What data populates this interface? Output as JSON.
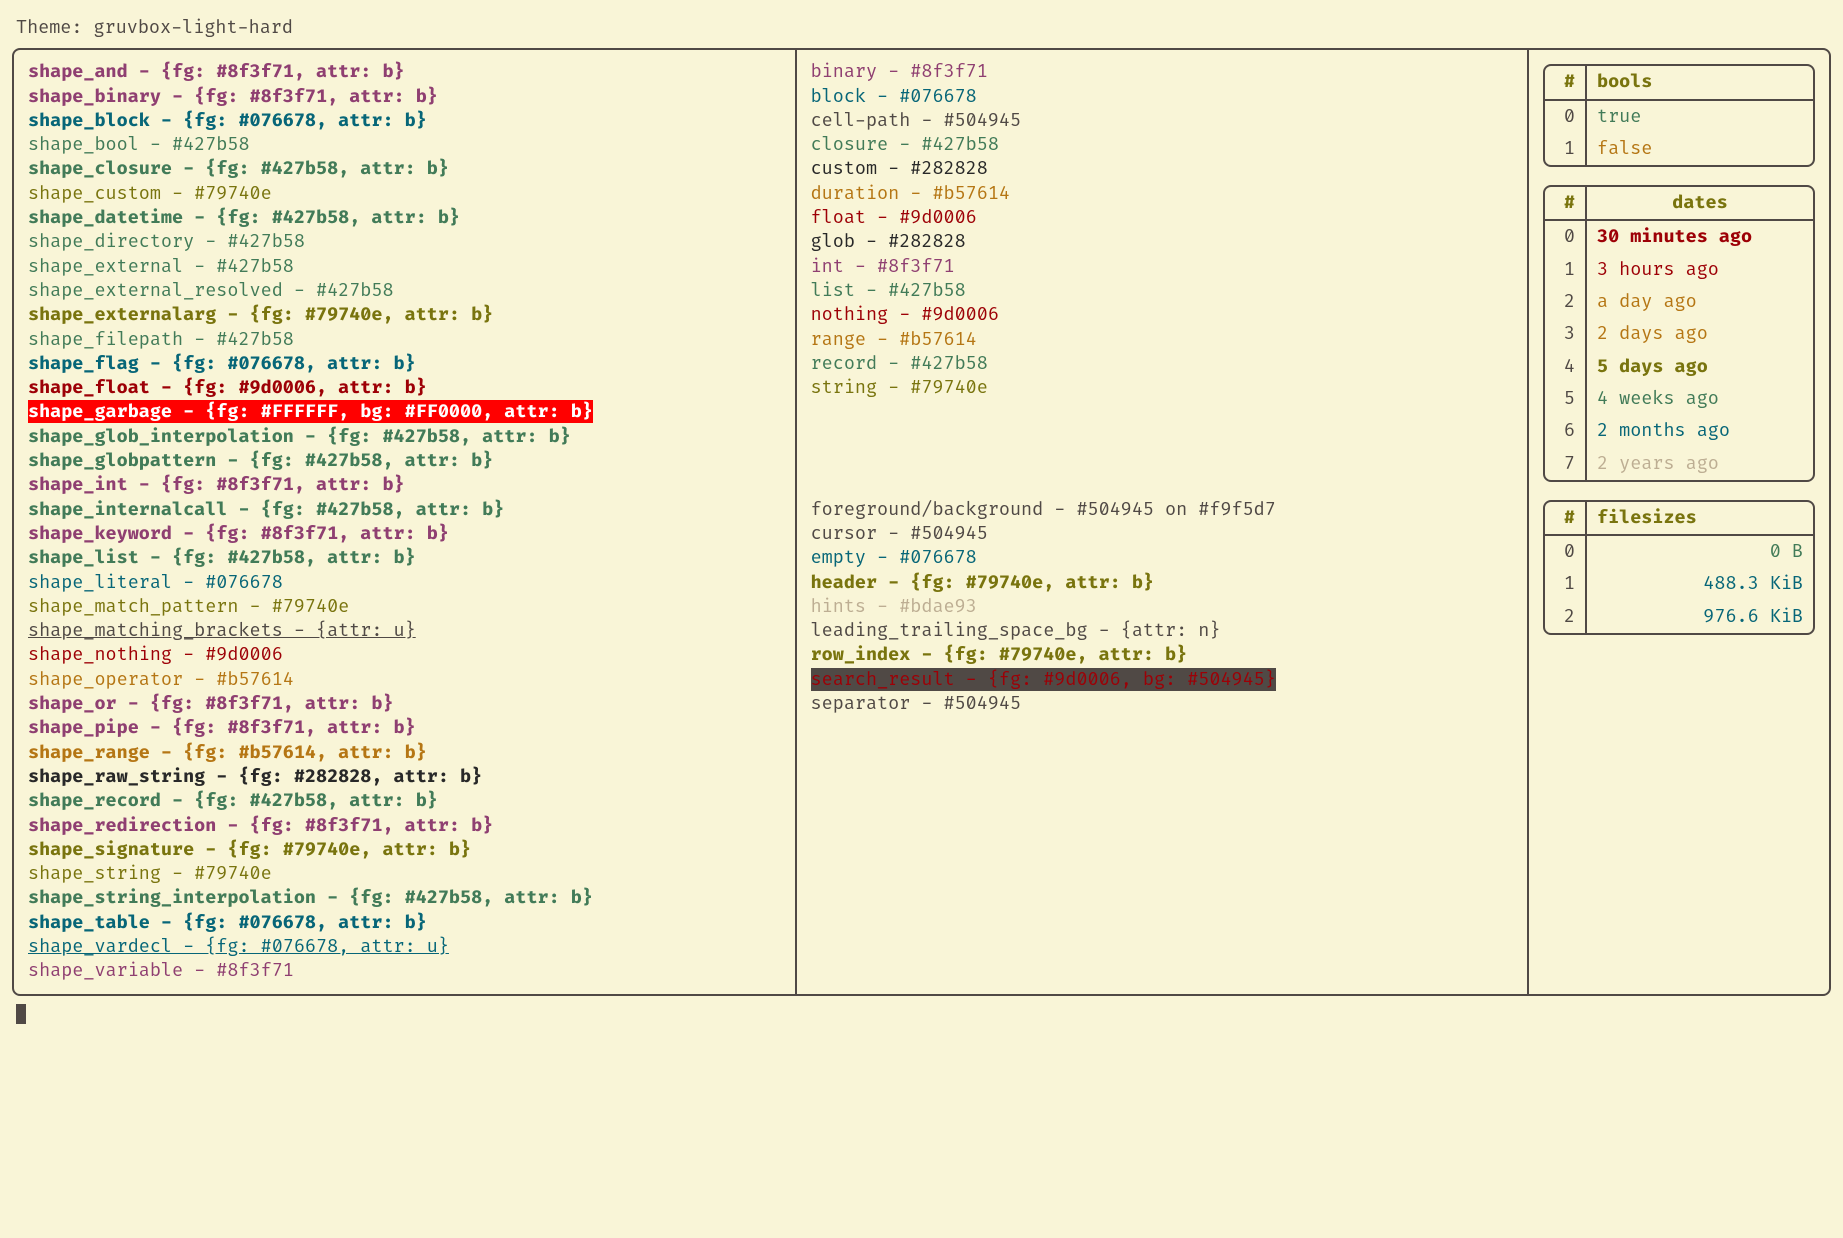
{
  "title_prefix": "Theme: ",
  "theme_name": "gruvbox-light-hard",
  "dash": " - ",
  "shapes": [
    {
      "name": "shape_and",
      "disp": "{fg: #8f3f71, attr: b}",
      "fg": "#8f3f71",
      "bold": true
    },
    {
      "name": "shape_binary",
      "disp": "{fg: #8f3f71, attr: b}",
      "fg": "#8f3f71",
      "bold": true
    },
    {
      "name": "shape_block",
      "disp": "{fg: #076678, attr: b}",
      "fg": "#076678",
      "bold": true
    },
    {
      "name": "shape_bool",
      "disp": "#427b58",
      "fg": "#427b58"
    },
    {
      "name": "shape_closure",
      "disp": "{fg: #427b58, attr: b}",
      "fg": "#427b58",
      "bold": true
    },
    {
      "name": "shape_custom",
      "disp": "#79740e",
      "fg": "#79740e"
    },
    {
      "name": "shape_datetime",
      "disp": "{fg: #427b58, attr: b}",
      "fg": "#427b58",
      "bold": true
    },
    {
      "name": "shape_directory",
      "disp": "#427b58",
      "fg": "#427b58"
    },
    {
      "name": "shape_external",
      "disp": "#427b58",
      "fg": "#427b58"
    },
    {
      "name": "shape_external_resolved",
      "disp": "#427b58",
      "fg": "#427b58"
    },
    {
      "name": "shape_externalarg",
      "disp": "{fg: #79740e, attr: b}",
      "fg": "#79740e",
      "bold": true
    },
    {
      "name": "shape_filepath",
      "disp": "#427b58",
      "fg": "#427b58"
    },
    {
      "name": "shape_flag",
      "disp": "{fg: #076678, attr: b}",
      "fg": "#076678",
      "bold": true
    },
    {
      "name": "shape_float",
      "disp": "{fg: #9d0006, attr: b}",
      "fg": "#9d0006",
      "bold": true
    },
    {
      "name": "shape_garbage",
      "disp": "{fg: #FFFFFF, bg: #FF0000, attr: b}",
      "fg": "#FFFFFF",
      "bg": "#FF0000",
      "bold": true,
      "garbage": true
    },
    {
      "name": "shape_glob_interpolation",
      "disp": "{fg: #427b58, attr: b}",
      "fg": "#427b58",
      "bold": true
    },
    {
      "name": "shape_globpattern",
      "disp": "{fg: #427b58, attr: b}",
      "fg": "#427b58",
      "bold": true
    },
    {
      "name": "shape_int",
      "disp": "{fg: #8f3f71, attr: b}",
      "fg": "#8f3f71",
      "bold": true
    },
    {
      "name": "shape_internalcall",
      "disp": "{fg: #427b58, attr: b}",
      "fg": "#427b58",
      "bold": true
    },
    {
      "name": "shape_keyword",
      "disp": "{fg: #8f3f71, attr: b}",
      "fg": "#8f3f71",
      "bold": true
    },
    {
      "name": "shape_list",
      "disp": "{fg: #427b58, attr: b}",
      "fg": "#427b58",
      "bold": true
    },
    {
      "name": "shape_literal",
      "disp": "#076678",
      "fg": "#076678"
    },
    {
      "name": "shape_match_pattern",
      "disp": "#79740e",
      "fg": "#79740e"
    },
    {
      "name": "shape_matching_brackets",
      "disp": "{attr: u}",
      "fg": "#504945",
      "underline": true
    },
    {
      "name": "shape_nothing",
      "disp": "#9d0006",
      "fg": "#9d0006"
    },
    {
      "name": "shape_operator",
      "disp": "#b57614",
      "fg": "#b57614"
    },
    {
      "name": "shape_or",
      "disp": "{fg: #8f3f71, attr: b}",
      "fg": "#8f3f71",
      "bold": true
    },
    {
      "name": "shape_pipe",
      "disp": "{fg: #8f3f71, attr: b}",
      "fg": "#8f3f71",
      "bold": true
    },
    {
      "name": "shape_range",
      "disp": "{fg: #b57614, attr: b}",
      "fg": "#b57614",
      "bold": true
    },
    {
      "name": "shape_raw_string",
      "disp": "{fg: #282828, attr: b}",
      "fg": "#282828",
      "bold": true
    },
    {
      "name": "shape_record",
      "disp": "{fg: #427b58, attr: b}",
      "fg": "#427b58",
      "bold": true
    },
    {
      "name": "shape_redirection",
      "disp": "{fg: #8f3f71, attr: b}",
      "fg": "#8f3f71",
      "bold": true
    },
    {
      "name": "shape_signature",
      "disp": "{fg: #79740e, attr: b}",
      "fg": "#79740e",
      "bold": true
    },
    {
      "name": "shape_string",
      "disp": "#79740e",
      "fg": "#79740e"
    },
    {
      "name": "shape_string_interpolation",
      "disp": "{fg: #427b58, attr: b}",
      "fg": "#427b58",
      "bold": true
    },
    {
      "name": "shape_table",
      "disp": "{fg: #076678, attr: b}",
      "fg": "#076678",
      "bold": true
    },
    {
      "name": "shape_vardecl",
      "disp": "{fg: #076678, attr: u}",
      "fg": "#076678",
      "underline": true
    },
    {
      "name": "shape_variable",
      "disp": "#8f3f71",
      "fg": "#8f3f71"
    }
  ],
  "types": [
    {
      "name": "binary",
      "disp": "#8f3f71",
      "fg": "#8f3f71"
    },
    {
      "name": "block",
      "disp": "#076678",
      "fg": "#076678"
    },
    {
      "name": "cell-path",
      "disp": "#504945",
      "fg": "#504945"
    },
    {
      "name": "closure",
      "disp": "#427b58",
      "fg": "#427b58"
    },
    {
      "name": "custom",
      "disp": "#282828",
      "fg": "#282828"
    },
    {
      "name": "duration",
      "disp": "#b57614",
      "fg": "#b57614"
    },
    {
      "name": "float",
      "disp": "#9d0006",
      "fg": "#9d0006"
    },
    {
      "name": "glob",
      "disp": "#282828",
      "fg": "#282828"
    },
    {
      "name": "int",
      "disp": "#8f3f71",
      "fg": "#8f3f71"
    },
    {
      "name": "list",
      "disp": "#427b58",
      "fg": "#427b58"
    },
    {
      "name": "nothing",
      "disp": "#9d0006",
      "fg": "#9d0006"
    },
    {
      "name": "range",
      "disp": "#b57614",
      "fg": "#b57614"
    },
    {
      "name": "record",
      "disp": "#427b58",
      "fg": "#427b58"
    },
    {
      "name": "string",
      "disp": "#79740e",
      "fg": "#79740e"
    }
  ],
  "misc": [
    {
      "name": "foreground/background",
      "disp": "#504945 on #f9f5d7",
      "fg": "#504945"
    },
    {
      "name": "cursor",
      "disp": "#504945",
      "fg": "#504945"
    },
    {
      "name": "empty",
      "disp": "#076678",
      "fg": "#076678"
    },
    {
      "name": "header",
      "disp": "{fg: #79740e, attr: b}",
      "fg": "#79740e",
      "bold": true
    },
    {
      "name": "hints",
      "disp": "#bdae93",
      "fg": "#bdae93"
    },
    {
      "name": "leading_trailing_space_bg",
      "disp": "{attr: n}",
      "fg": "#504945"
    },
    {
      "name": "row_index",
      "disp": "{fg: #79740e, attr: b}",
      "fg": "#79740e",
      "bold": true
    },
    {
      "name": "search_result",
      "disp": "{fg: #9d0006, bg: #504945}",
      "fg": "#9d0006",
      "bg": "#504945",
      "search": true
    },
    {
      "name": "separator",
      "disp": "#504945",
      "fg": "#504945"
    }
  ],
  "tables": {
    "bools": {
      "header": "bools",
      "rows": [
        {
          "idx": "0",
          "val": "true",
          "fg": "#427b58"
        },
        {
          "idx": "1",
          "val": "false",
          "fg": "#b57614"
        }
      ]
    },
    "dates": {
      "header": "dates",
      "rows": [
        {
          "idx": "0",
          "val": "30 minutes ago",
          "fg": "#9d0006",
          "bold": true
        },
        {
          "idx": "1",
          "val": "3 hours ago",
          "fg": "#9d0006"
        },
        {
          "idx": "2",
          "val": "a day ago",
          "fg": "#b57614"
        },
        {
          "idx": "3",
          "val": "2 days ago",
          "fg": "#b57614"
        },
        {
          "idx": "4",
          "val": "5 days ago",
          "fg": "#79740e",
          "bold": true
        },
        {
          "idx": "5",
          "val": "4 weeks ago",
          "fg": "#427b58"
        },
        {
          "idx": "6",
          "val": "2 months ago",
          "fg": "#076678"
        },
        {
          "idx": "7",
          "val": "2 years ago",
          "fg": "#bdae93"
        }
      ]
    },
    "filesizes": {
      "header": "filesizes",
      "rows": [
        {
          "idx": "0",
          "val": "0 B",
          "fg": "#427b58",
          "right": true
        },
        {
          "idx": "1",
          "val": "488.3 KiB",
          "fg": "#076678",
          "right": true
        },
        {
          "idx": "2",
          "val": "976.6 KiB",
          "fg": "#076678",
          "right": true
        }
      ]
    }
  },
  "hash_header": "#"
}
